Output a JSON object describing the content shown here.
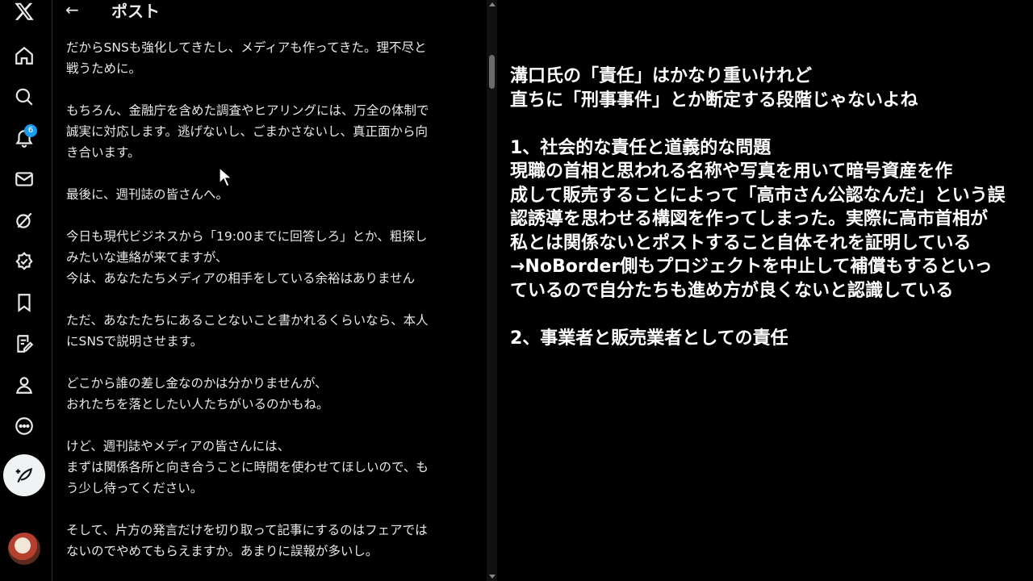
{
  "sidebar": {
    "notification_count": "6",
    "items": [
      {
        "name": "x-logo-icon"
      },
      {
        "name": "home-icon"
      },
      {
        "name": "search-icon"
      },
      {
        "name": "notifications-icon"
      },
      {
        "name": "messages-icon"
      },
      {
        "name": "grok-icon"
      },
      {
        "name": "verified-icon"
      },
      {
        "name": "bookmarks-icon"
      },
      {
        "name": "articles-icon"
      },
      {
        "name": "profile-icon"
      },
      {
        "name": "more-icon"
      }
    ]
  },
  "post": {
    "back_label": "←",
    "title": "ポスト",
    "paragraphs": [
      [
        "だからSNSも強化してきたし、メディアも作ってきた。理不尽と",
        "戦うために。"
      ],
      [
        "もちろん、金融庁を含めた調査やヒアリングには、万全の体制で",
        "誠実に対応します。逃げないし、ごまかさないし、真正面から向",
        "き合います。"
      ],
      [
        "最後に、週刊誌の皆さんへ。"
      ],
      [
        "今日も現代ビジネスから「19:00までに回答しろ」とか、粗探し",
        "みたいな連絡が来てますが、",
        "今は、あなたたちメディアの相手をしている余裕はありません"
      ],
      [
        "ただ、あなたたちにあることないこと書かれるくらいなら、本人",
        "にSNSで説明させます。"
      ],
      [
        "どこから誰の差し金なのかは分かりませんが、",
        "おれたちを落としたい人たちがいるのかもね。"
      ],
      [
        "けど、週刊誌やメディアの皆さんには、",
        "まずは関係各所と向き合うことに時間を使わせてほしいので、も",
        "う少し待ってください。"
      ],
      [
        "そして、片方の発言だけを切り取って記事にするのはフェアでは",
        "ないのでやめてもらえますか。あまりに誤報が多いし。"
      ]
    ]
  },
  "notes": {
    "lines": [
      "溝口氏の「責任」はかなり重いけれど",
      "直ちに「刑事事件」とか断定する段階じゃないよね",
      "",
      "1、社会的な責任と道義的な問題",
      "現職の首相と思われる名称や写真を用いて暗号資産を作",
      "成して販売することによって「高市さん公認なんだ」という誤",
      "認誘導を思わせる構図を作ってしまった。実際に高市首相が",
      "私とは関係ないとポストすること自体それを証明している",
      "→NoBorder側もプロジェクトを中止して補償もするといっ",
      "ているので自分たちも進め方が良くないと認識している",
      "",
      "2、事業者と販売業者としての責任"
    ]
  },
  "colors": {
    "accent": "#1d9bf0",
    "background": "#000000",
    "text": "#e7e9ea"
  }
}
